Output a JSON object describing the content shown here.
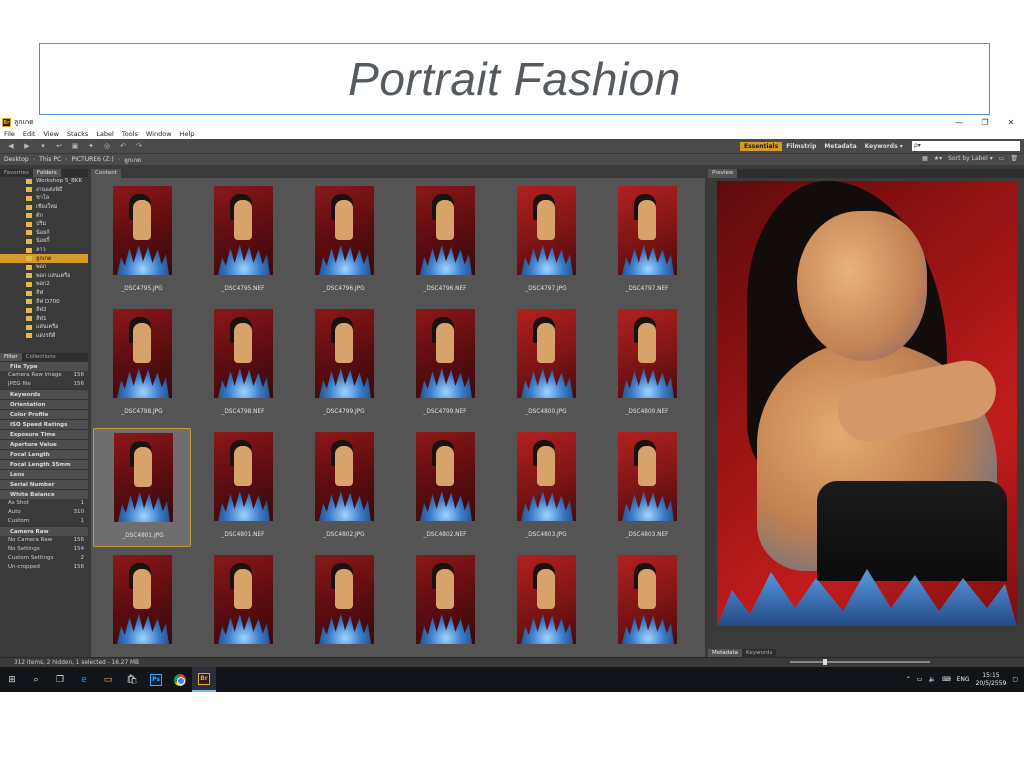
{
  "slide": {
    "title": "Portrait Fashion"
  },
  "window": {
    "app_icon": "Br",
    "title": "ลูกเกด",
    "controls": [
      "—",
      "❐",
      "✕"
    ]
  },
  "menu": [
    "File",
    "Edit",
    "View",
    "Stacks",
    "Label",
    "Tools",
    "Window",
    "Help"
  ],
  "workspaces": {
    "items": [
      "Essentials",
      "Filmstrip",
      "Metadata",
      "Keywords ▾"
    ],
    "active": "Essentials"
  },
  "search": {
    "placeholder": "ρ▾"
  },
  "path": {
    "segments": [
      "Desktop",
      "This PC",
      "PICTURE6 (Z:)",
      "ลูกเกด"
    ]
  },
  "sort": {
    "label": "Sort by Label ▾"
  },
  "left_tabs": [
    "Favorites",
    "Folders"
  ],
  "folders": [
    "Workshop 5_BKK",
    "งานแต่งพิธี",
    "ชาโล",
    "เชียงใหม่",
    "ตัก",
    "ปริม",
    "น้อยก้",
    "น้อยกิ้",
    "ลาว",
    "ลูกเกด",
    "พอก",
    "พอก แสนเครือ",
    "พอก2",
    "ลีฬ",
    "ลีฬ D700",
    "ลีฬ2",
    "ลีฬ1",
    "แสนเครือ",
    "แสงรถีดี"
  ],
  "selected_folder": "ลูกเกด",
  "filter_tabs": [
    "Filter",
    "Collections"
  ],
  "filters": [
    {
      "head": "File Type",
      "rows": [
        [
          "Camera Raw image",
          "156"
        ],
        [
          "JPEG file",
          "156"
        ]
      ]
    },
    {
      "head": "Keywords",
      "rows": []
    },
    {
      "head": "Orientation",
      "rows": []
    },
    {
      "head": "Color Profile",
      "rows": []
    },
    {
      "head": "ISO Speed Ratings",
      "rows": []
    },
    {
      "head": "Exposure Time",
      "rows": []
    },
    {
      "head": "Aperture Value",
      "rows": []
    },
    {
      "head": "Focal Length",
      "rows": []
    },
    {
      "head": "Focal Length 35mm",
      "rows": []
    },
    {
      "head": "Lens",
      "rows": []
    },
    {
      "head": "Serial Number",
      "rows": []
    },
    {
      "head": "White Balance",
      "rows": [
        [
          "As Shot",
          "1"
        ],
        [
          "Auto",
          "310"
        ],
        [
          "Custom",
          "1"
        ]
      ]
    },
    {
      "head": "Camera Raw",
      "rows": [
        [
          "No Camera Raw",
          "156"
        ],
        [
          "No Settings",
          "154"
        ],
        [
          "Custom Settings",
          "2"
        ],
        [
          "Un-cropped",
          "156"
        ]
      ]
    }
  ],
  "content_tab": "Content",
  "thumbnails": [
    "_DSC4795.JPG",
    "_DSC4795.NEF",
    "_DSC4796.JPG",
    "_DSC4796.NEF",
    "_DSC4797.JPG",
    "_DSC4797.NEF",
    "_DSC4798.JPG",
    "_DSC4798.NEF",
    "_DSC4799.JPG",
    "_DSC4799.NEF",
    "_DSC4800.JPG",
    "_DSC4800.NEF",
    "_DSC4801.JPG",
    "_DSC4801.NEF",
    "_DSC4802.JPG",
    "_DSC4802.NEF",
    "_DSC4803.JPG",
    "_DSC4803.NEF",
    "",
    "",
    "",
    "",
    "",
    ""
  ],
  "selected_thumbnail": "_DSC4801.JPG",
  "preview_tab": "Preview",
  "bottom_tabs": [
    "Metadata",
    "Keywords"
  ],
  "status": "312 items, 2 hidden, 1 selected - 16.27 MB",
  "taskbar": {
    "lang": "ENG",
    "time": "15:15",
    "date": "20/5/2559"
  }
}
